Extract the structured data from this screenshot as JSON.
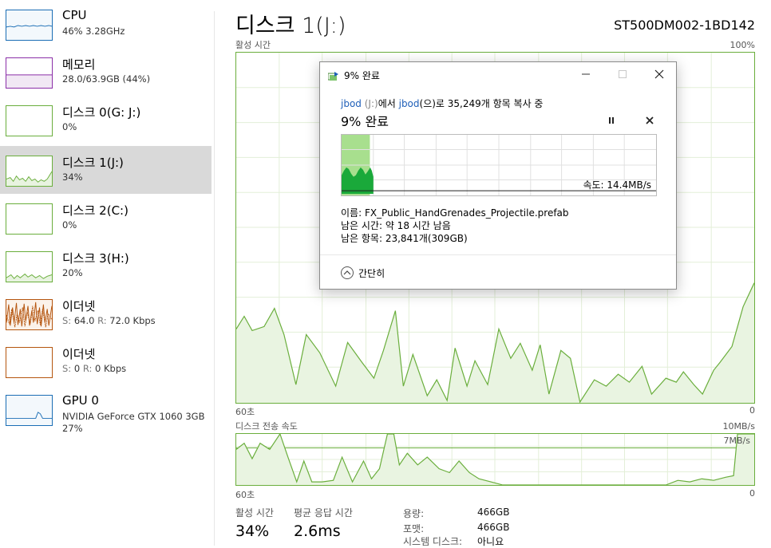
{
  "sidebar": {
    "items": [
      {
        "name": "CPU",
        "l2": "46% 3.28GHz",
        "l3": ""
      },
      {
        "name": "메모리",
        "l2": "28.0/63.9GB (44%)",
        "l3": ""
      },
      {
        "name": "디스크 0(G: J:)",
        "l2": "0%",
        "l3": ""
      },
      {
        "name": "디스크 1(J:)",
        "l2": "34%",
        "l3": ""
      },
      {
        "name": "디스크 2(C:)",
        "l2": "0%",
        "l3": ""
      },
      {
        "name": "디스크 3(H:)",
        "l2": "20%",
        "l3": ""
      },
      {
        "name": "이더넷",
        "l2": "",
        "l3": "",
        "s_label": "S:",
        "s_val": "64.0",
        "r_label": "R:",
        "r_val": "72.0 Kbps"
      },
      {
        "name": "이더넷",
        "l2": "",
        "l3": "",
        "s_label": "S:",
        "s_val": "0",
        "r_label": "R:",
        "r_val": "0 Kbps"
      },
      {
        "name": "GPU 0",
        "l2": "NVIDIA GeForce GTX 1060 3GB",
        "l3": "27%"
      }
    ],
    "selected_index": 3
  },
  "main": {
    "title": "디스크 1(J:)",
    "model": "ST500DM002-1BD142",
    "active_graph": {
      "label": "활성 시간",
      "max_label": "100%",
      "time_label": "60초",
      "min_label": "0"
    },
    "transfer_graph": {
      "label": "디스크 전송 속도",
      "max_label": "10MB/s",
      "ref_label": "7MB/s",
      "time_label": "60초",
      "min_label": "0"
    },
    "stats": {
      "active_label": "활성 시간",
      "active_value": "34%",
      "response_label": "평균 응답 시간",
      "response_value": "2.6ms"
    },
    "props": [
      {
        "label": "용량:",
        "value": "466GB"
      },
      {
        "label": "포맷:",
        "value": "466GB"
      },
      {
        "label": "시스템 디스크:",
        "value": "아니요"
      }
    ]
  },
  "dialog": {
    "title": "9% 완료",
    "msg_src_name": "jbod",
    "msg_src_drive": "(J:)",
    "msg_mid": "에서 ",
    "msg_dst_name": "jbod",
    "msg_tail": "(으)로 35,249개 항목 복사 중",
    "percent_text": "9% 완료",
    "speed_label": "속도: 14.4MB/s",
    "progress": 0.09,
    "name_line": "이름: FX_Public_HandGrenades_Projectile.prefab",
    "time_line": "남은 시간: 약 18 시간 남음",
    "items_line": "남은 항목: 23,841개(309GB)",
    "collapse_label": "간단히"
  },
  "colors": {
    "cpu": "#1b6eb5",
    "memory": "#8b2fa8",
    "disk": "#6aae3c",
    "ethernet": "#b5550e",
    "gpu": "#1b6eb5",
    "selected_bg": "#d9d9d9",
    "link": "#1f5fb8",
    "progress_fill": "#1aa93a"
  }
}
